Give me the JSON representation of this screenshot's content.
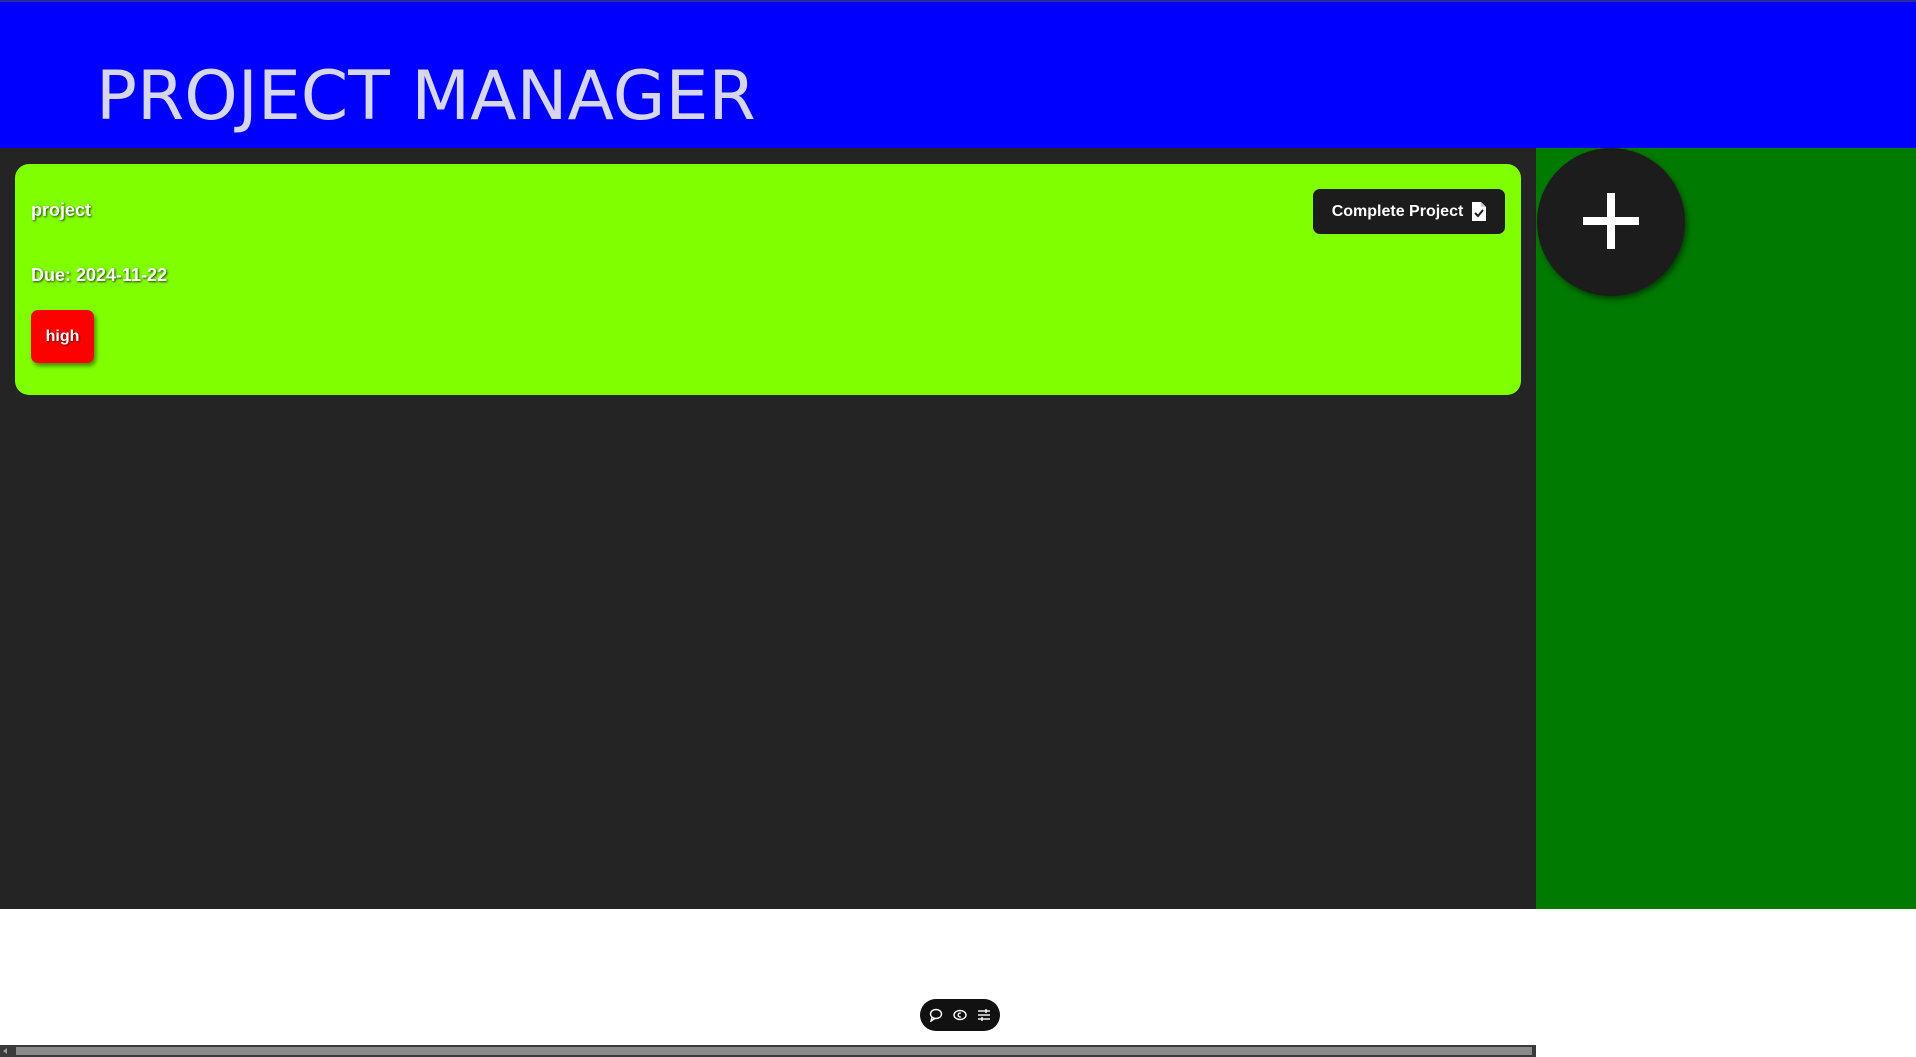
{
  "header": {
    "title": "PROJECT MANAGER",
    "background": "#0000ff"
  },
  "projects": [
    {
      "title": "project",
      "due": "Due: 2024-11-22",
      "priority": "high",
      "card_color": "#80ff00",
      "priority_color": "#ff0000",
      "action_label": "Complete Project",
      "action_icon": "file-check-icon"
    }
  ],
  "sidebar": {
    "background": "#007a00",
    "add_button_icon": "plus-icon"
  },
  "floating_toolbar": {
    "icons": [
      "comment-icon",
      "caption-icon",
      "settings-sliders-icon"
    ]
  },
  "colors": {
    "main_background": "#242424",
    "button_dark": "#1c1c1c"
  }
}
